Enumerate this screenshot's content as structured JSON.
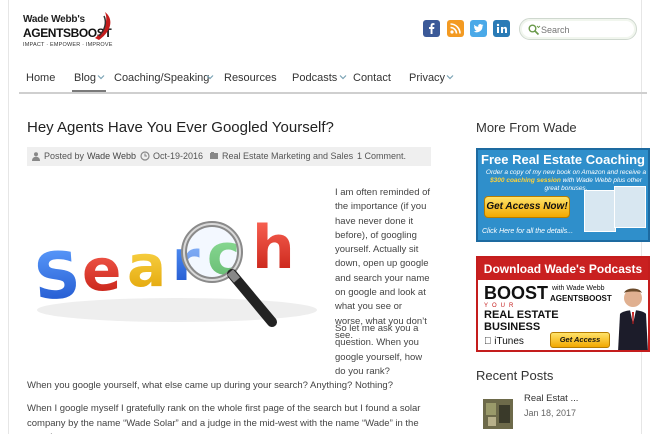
{
  "logo": {
    "line1": "Wade Webb's",
    "line2": "AGENTSBOOST",
    "tagline": "IMPACT · EMPOWER · IMPROVE"
  },
  "social": [
    "facebook-icon",
    "rss-icon",
    "twitter-icon",
    "linkedin-icon"
  ],
  "search": {
    "placeholder": "Search"
  },
  "nav": {
    "items": [
      {
        "label": "Home",
        "dropdown": false
      },
      {
        "label": "Blog",
        "dropdown": true
      },
      {
        "label": "Coaching/Speaking",
        "dropdown": true
      },
      {
        "label": "Resources",
        "dropdown": false
      },
      {
        "label": "Podcasts",
        "dropdown": true
      },
      {
        "label": "Contact",
        "dropdown": false
      },
      {
        "label": "Privacy",
        "dropdown": true
      }
    ],
    "active": "Blog"
  },
  "post": {
    "title": "Hey Agents Have You Ever Googled Yourself?",
    "meta": {
      "posted_by_label": "Posted by",
      "author": "Wade Webb",
      "date": "Oct-19-2016",
      "category": "Real Estate Marketing and Sales",
      "comments": "1 Comment."
    },
    "image_word": "Search",
    "side_para1": "I am often reminded of the importance (if you have never done it before), of googling yourself. Actually sit down, open up google and search your name on google and look at what you see or worse, what you don’t see.",
    "side_para2": "So let me ask you a question. When you google yourself, how do you rank?",
    "para3": "When you google yourself, what else came up during your search? Anything? Nothing?",
    "para4": "When I google myself I gratefully rank on the whole first page of the search but I found a solar company by the name “Wade Solar” and a judge in the mid-west with the name “Wade” in the search."
  },
  "sidebar": {
    "more_heading": "More From Wade",
    "ad1": {
      "title": "Free Real Estate Coaching",
      "subtitle_a": "Order a copy of my new book on Amazon and receive a ",
      "subtitle_b": "$300 coaching session",
      "subtitle_c": " with Wade Webb plus other great bonuses.",
      "button": "Get Access Now!",
      "footer": "Click Here for all the details..."
    },
    "ad2": {
      "header": "Download Wade's Podcasts",
      "boost": "BOOST",
      "your": "YOUR",
      "real_estate": "REAL ESTATE",
      "business": "BUSINESS",
      "with": "with Wade Webb",
      "brand": "AGENTSBOOST",
      "itunes": "iTunes",
      "button": "Get Access Now!"
    },
    "recent_heading": "Recent Posts",
    "recent": [
      {
        "title": "Real Estat ...",
        "date": "Jan 18, 2017"
      }
    ]
  },
  "colors": {
    "brand_red": "#c41d1d",
    "ad_blue": "#2f8fcb",
    "button_gold": "#f2a800"
  }
}
